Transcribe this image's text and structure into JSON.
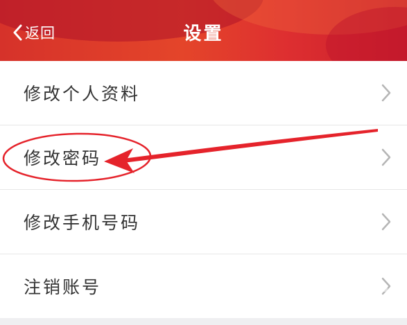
{
  "header": {
    "back_label": "返回",
    "title": "设置"
  },
  "settings": {
    "items": [
      {
        "label": "修改个人资料"
      },
      {
        "label": "修改密码"
      },
      {
        "label": "修改手机号码"
      },
      {
        "label": "注销账号"
      }
    ]
  },
  "icons": {
    "back": "chevron-left-icon",
    "row_arrow": "chevron-right-icon"
  },
  "colors": {
    "header": "#d6322a",
    "annotation": "#e5232b",
    "page_bg": "#efeff1"
  }
}
